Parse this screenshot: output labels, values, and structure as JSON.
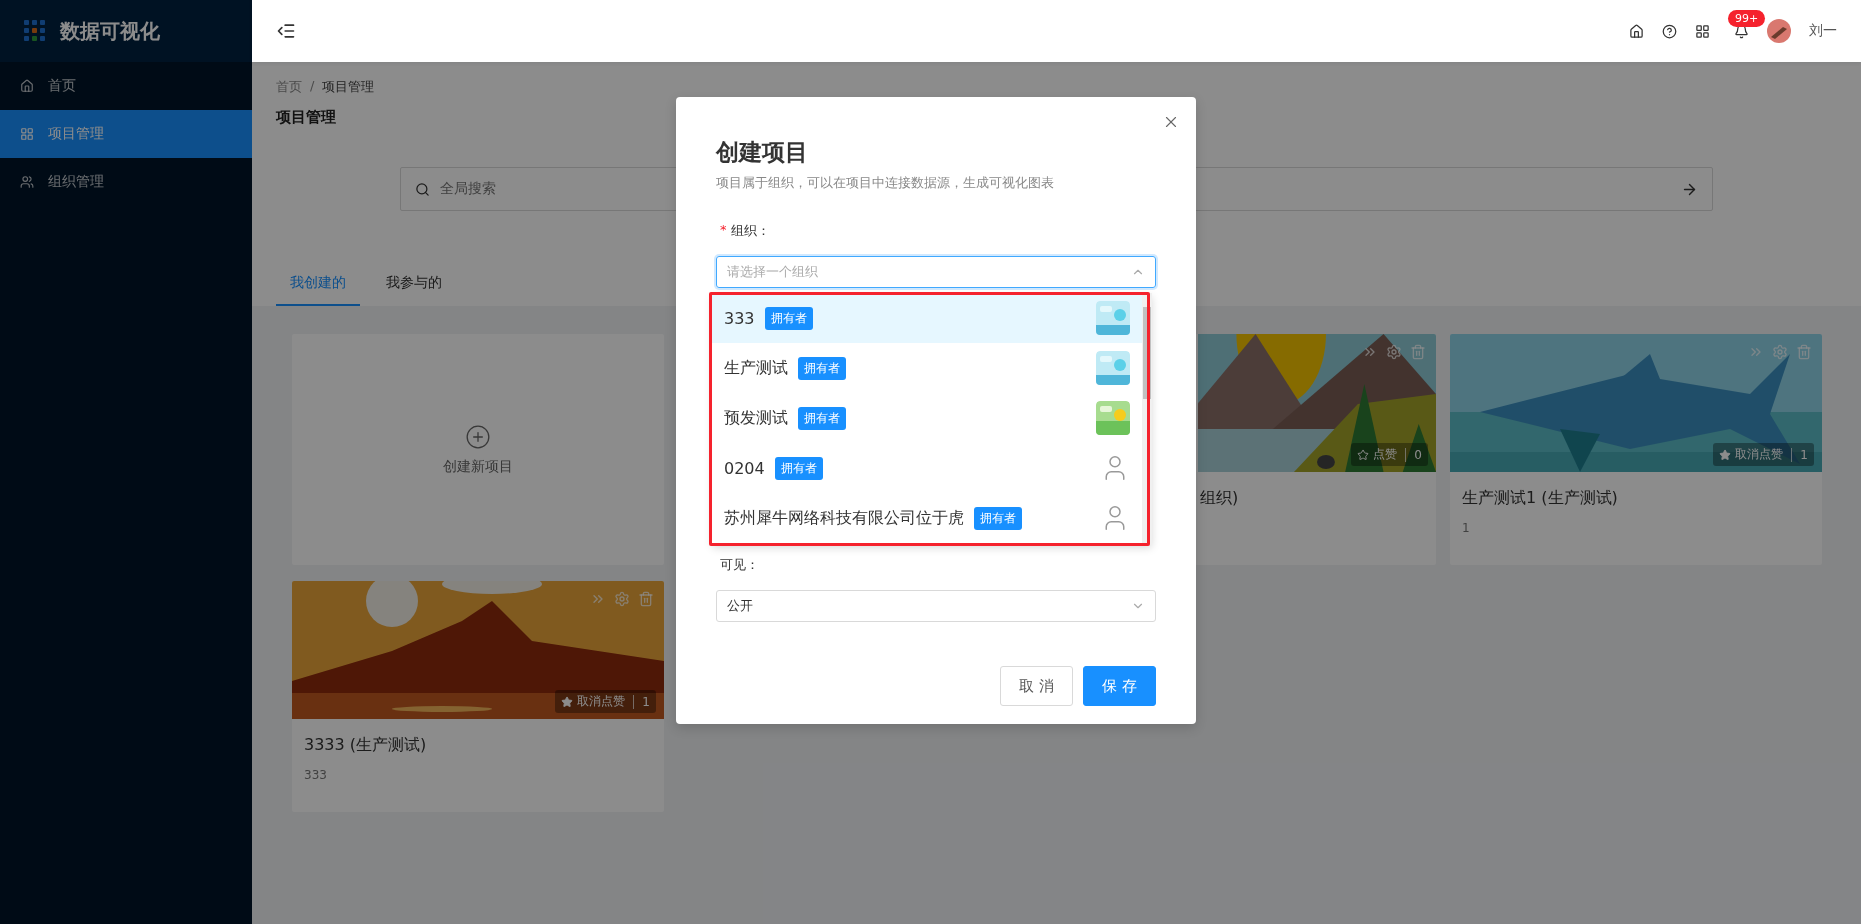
{
  "app": {
    "title": "数据可视化"
  },
  "sidebar": {
    "items": [
      {
        "label": "首页",
        "selected": false,
        "kind": "home"
      },
      {
        "label": "项目管理",
        "selected": true,
        "kind": "grid"
      },
      {
        "label": "组织管理",
        "selected": false,
        "kind": "people"
      }
    ]
  },
  "header": {
    "notification_count": "99+",
    "user": "刘一"
  },
  "breadcrumb": [
    "首页",
    "项目管理"
  ],
  "breadcrumb_separator": "/",
  "page_title": "项目管理",
  "search": {
    "placeholder": "全局搜索"
  },
  "tabs": [
    {
      "label": "我创建的",
      "selected": true
    },
    {
      "label": "我参与的",
      "selected": false
    }
  ],
  "create_card": {
    "label": "创建新项目"
  },
  "projects": [
    {
      "title": "组织)",
      "liked": false,
      "like_label": "点赞",
      "count": "0"
    },
    {
      "title": "生产测试1 (生产测试)",
      "description": "1",
      "liked": true,
      "like_label": "取消点赞",
      "count": "1"
    },
    {
      "title": "3333 (生产测试)",
      "description": "333",
      "liked": true,
      "like_label": "取消点赞",
      "count": "1"
    }
  ],
  "dialog": {
    "title": "创建项目",
    "subtitle": "项目属于组织，可以在项目中连接数据源，生成可视化图表",
    "org_field": {
      "required_mark": "*",
      "label": "组织：",
      "placeholder": "请选择一个组织",
      "expanded": true
    },
    "annotation_frame": true,
    "org_options": [
      {
        "name": "333",
        "badge": "拥有者",
        "kind": "picture",
        "selected": true
      },
      {
        "name": "生产测试",
        "badge": "拥有者",
        "kind": "picture",
        "selected": false
      },
      {
        "name": "预发测试",
        "badge": "拥有者",
        "kind": "picture",
        "selected": false
      },
      {
        "name": "0204",
        "badge": "拥有者",
        "kind": "person",
        "selected": false
      },
      {
        "name": "苏州犀牛网络科技有限公司位于虎",
        "badge": "拥有者",
        "kind": "person",
        "selected": false
      }
    ],
    "visibility_field": {
      "label": "可见：",
      "value": "公开"
    },
    "buttons": [
      {
        "label": "取 消",
        "kind": "default"
      },
      {
        "label": "保 存",
        "kind": "primary"
      }
    ]
  }
}
